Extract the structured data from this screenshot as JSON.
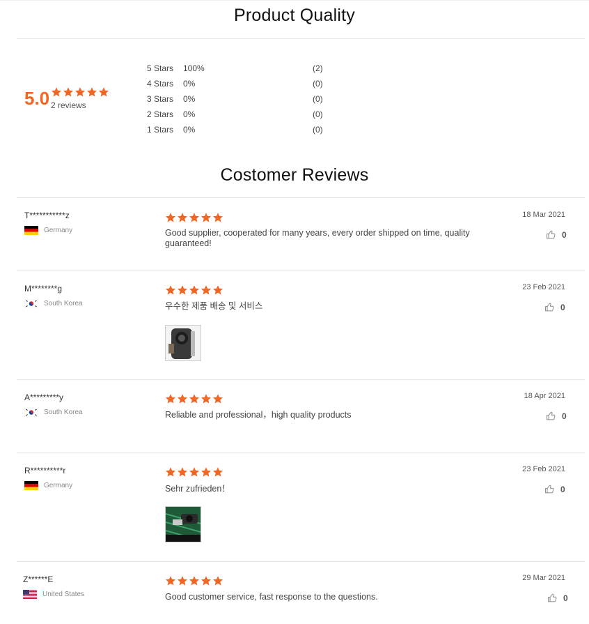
{
  "colors": {
    "accent": "#f06622",
    "divider": "#e6e6e6",
    "text": "#333333"
  },
  "quality": {
    "title": "Product Quality",
    "score": "5.0",
    "reviews_count": "2 reviews",
    "star_rating": 5,
    "distribution": [
      {
        "label": "5 Stars",
        "percent": "100%",
        "count": "(2)"
      },
      {
        "label": "4 Stars",
        "percent": "0%",
        "count": "(0)"
      },
      {
        "label": "3 Stars",
        "percent": "0%",
        "count": "(0)"
      },
      {
        "label": "2 Stars",
        "percent": "0%",
        "count": "(0)"
      },
      {
        "label": "1 Stars",
        "percent": "0%",
        "count": "(0)"
      }
    ]
  },
  "reviews_section": {
    "title": "Costomer Reviews",
    "reviews": [
      {
        "name": "T***********z",
        "country": "Germany",
        "flag": "germany-flag-icon",
        "rating": 5,
        "text": "Good supplier, cooperated for many years, every order shipped on time, quality guaranteed!",
        "date": "18 Mar 2021",
        "likes": "0",
        "has_photo": false
      },
      {
        "name": "M********g",
        "country": "South Korea",
        "flag": "south-korea-flag-icon",
        "rating": 5,
        "text": "우수한 제품 배송 및 서비스",
        "date": "23 Feb 2021",
        "likes": "0",
        "has_photo": true,
        "photo": "product-photo-thumbnail"
      },
      {
        "name": "A*********y",
        "country": "South Korea",
        "flag": "south-korea-flag-icon",
        "rating": 5,
        "text": "Reliable and professional，high quality products",
        "date": "18 Apr 2021",
        "likes": "0",
        "has_photo": false
      },
      {
        "name": "R**********r",
        "country": "Germany",
        "flag": "germany-flag-icon",
        "rating": 5,
        "text": "Sehr zufrieden！",
        "date": "23 Feb 2021",
        "likes": "0",
        "has_photo": true,
        "photo": "product-photo-thumbnail"
      },
      {
        "name": "Z******E",
        "country": "United States",
        "flag": "united-states-flag-icon",
        "rating": 5,
        "text": "Good customer service, fast response to the questions.",
        "date": "29 Mar 2021",
        "likes": "0",
        "has_photo": false
      }
    ]
  },
  "icons": {
    "star": "star-icon",
    "like": "thumbs-up-icon"
  }
}
